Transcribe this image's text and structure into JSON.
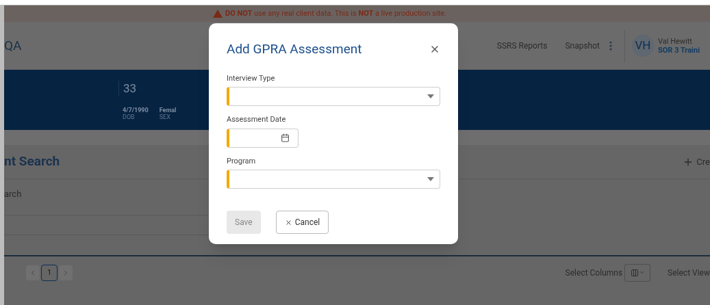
{
  "banner": {
    "text": "**DO NOT** use any real client data. This is **NOT** a live production site."
  },
  "header": {
    "app_title": "QA",
    "nav": [
      "SSRS Reports",
      "Snapshot"
    ],
    "user": {
      "initials": "VH",
      "name": "Val Hewitt",
      "role": "SOR 3 Traini"
    }
  },
  "client_band": {
    "age": "33",
    "facts": [
      {
        "value": "4/7/1990",
        "label": "DOB"
      },
      {
        "value": "Femal",
        "label": "SEX"
      }
    ]
  },
  "section": {
    "title": "nt Search",
    "create_label": "Cre",
    "search_label": "arch"
  },
  "pagination": {
    "pages": [
      {
        "label": "1",
        "selected": true
      }
    ]
  },
  "table_tools": {
    "select_columns": "Select Columns",
    "select_view": "Select View"
  },
  "dialog": {
    "title": "Add GPRA Assessment",
    "fields": [
      {
        "label": "Interview Type",
        "kind": "select",
        "required": true
      },
      {
        "label": "Assessment Date",
        "kind": "date",
        "required": true
      },
      {
        "label": "Program",
        "kind": "select",
        "required": true
      }
    ],
    "buttons": [
      {
        "label": "Save",
        "kind": "primary",
        "disabled": true
      },
      {
        "label": "Cancel",
        "kind": "cancel",
        "disabled": false
      }
    ]
  }
}
